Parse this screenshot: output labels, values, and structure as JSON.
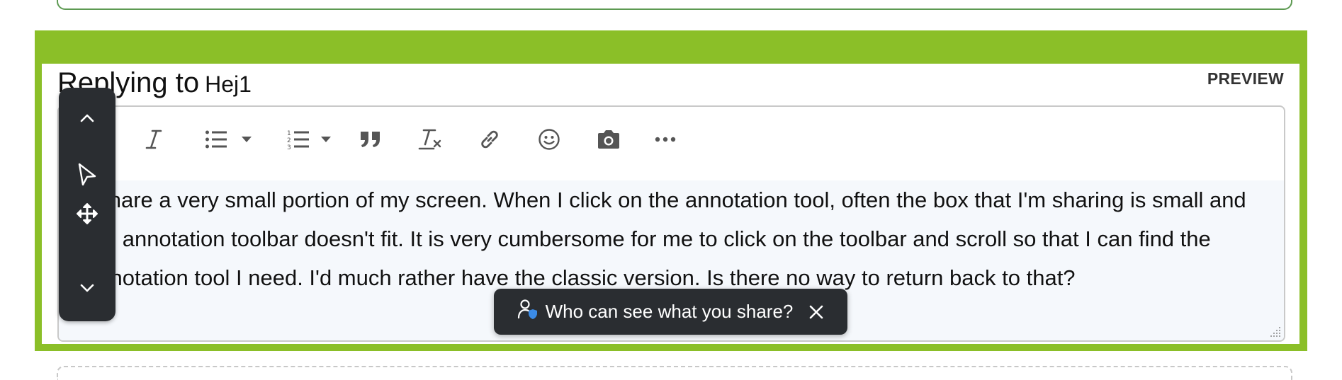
{
  "reply": {
    "label": "Replying to",
    "user": "Hej1",
    "preview_label": "PREVIEW"
  },
  "toolbar": {
    "buttons": [
      {
        "name": "italic",
        "icon": "italic-icon"
      },
      {
        "name": "bulleted-list",
        "icon": "bulleted-list-icon"
      },
      {
        "name": "numbered-list",
        "icon": "numbered-list-icon"
      },
      {
        "name": "blockquote",
        "icon": "quote-icon"
      },
      {
        "name": "clear-formatting",
        "icon": "clear-format-icon"
      },
      {
        "name": "insert-link",
        "icon": "link-icon"
      },
      {
        "name": "insert-emoji",
        "icon": "emoji-icon"
      },
      {
        "name": "insert-image",
        "icon": "camera-icon"
      },
      {
        "name": "more",
        "icon": "more-icon"
      }
    ]
  },
  "editor": {
    "body": "I share a very small portion of my screen. When I click on the annotation tool, often the box that I'm sharing is small and the annotation toolbar doesn't fit. It is very cumbersome for me to click on the toolbar and scroll so that I can find the annotation tool I need. I'd much rather have the classic version. Is there no way to return back to that?"
  },
  "side_toolbar": {
    "buttons": [
      "chevron-up-icon",
      "pointer-icon",
      "move-icon",
      "chevron-down-icon"
    ]
  },
  "privacy": {
    "label": "Who can see what you share?"
  },
  "colors": {
    "frame_green": "#8bbf28",
    "dark_ui": "#2a2d31",
    "editor_bg": "#f5f8fc",
    "shield_blue": "#3b8be6"
  }
}
